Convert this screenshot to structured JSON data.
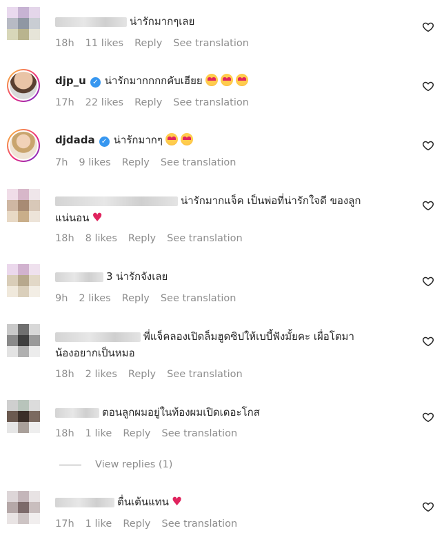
{
  "comments": [
    {
      "username": "",
      "text": "น่ารักมากๆเลย",
      "text2": "",
      "time": "18h",
      "likes": "11 likes",
      "reply": "Reply",
      "translate": "See translation",
      "verified": false
    },
    {
      "username": "djp_u",
      "text": "น่ารักมากกกกคับเฮียย",
      "text2": "",
      "time": "17h",
      "likes": "22 likes",
      "reply": "Reply",
      "translate": "See translation",
      "verified": true
    },
    {
      "username": "djdada",
      "text": "น่ารักมากๆ",
      "text2": "",
      "time": "7h",
      "likes": "9 likes",
      "reply": "Reply",
      "translate": "See translation",
      "verified": true
    },
    {
      "username": "",
      "text": "น่ารักมากแจ็ค เป็นพ่อที่น่ารักใจดี ของลูก",
      "text2": "แน่นอน",
      "time": "18h",
      "likes": "8 likes",
      "reply": "Reply",
      "translate": "See translation",
      "verified": false
    },
    {
      "username": "",
      "text": "3 น่ารักจังเลย",
      "text2": "",
      "time": "9h",
      "likes": "2 likes",
      "reply": "Reply",
      "translate": "See translation",
      "verified": false
    },
    {
      "username": "",
      "text": "พี่แจ็คลองเปิดล็มฮูดซิปให้เบบี้ฟังมั้ยคะ เผื่อโตมา",
      "text2": "น้องอยากเป็นหมอ",
      "time": "18h",
      "likes": "2 likes",
      "reply": "Reply",
      "translate": "See translation",
      "verified": false
    },
    {
      "username": "",
      "text": "ตอนลูกผมอยู่ในท้องผมเปิดเดอะโกส",
      "text2": "",
      "time": "18h",
      "likes": "1 like",
      "reply": "Reply",
      "translate": "See translation",
      "verified": false
    },
    {
      "username": "",
      "text": "ตื่นเต้นแทน",
      "text2": "",
      "time": "17h",
      "likes": "1 like",
      "reply": "Reply",
      "translate": "See translation",
      "verified": false
    }
  ],
  "view_replies": "View replies (1)",
  "colors": {
    "heart": "#e0245e",
    "verified": "#3797f0",
    "meta": "#8e8e8e"
  },
  "icons": {
    "like": "heart-outline-icon",
    "verified": "verified-badge-icon"
  }
}
